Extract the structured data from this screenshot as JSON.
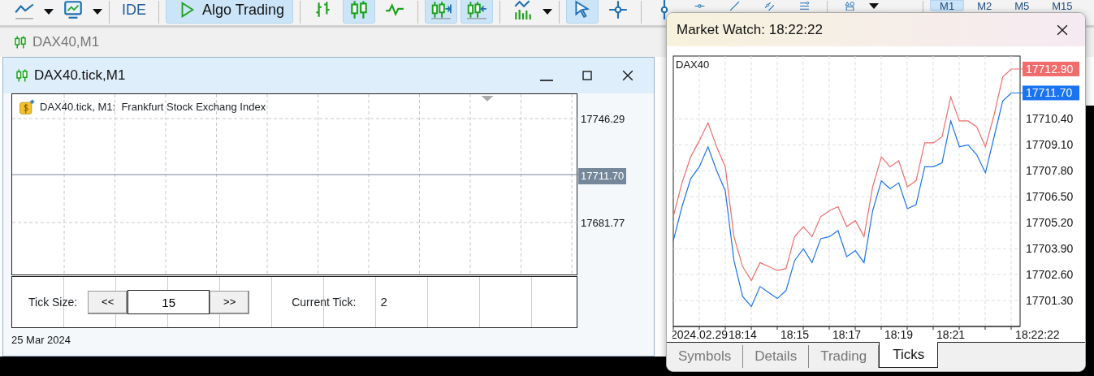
{
  "toolbar": {
    "items": [
      {
        "kind": "icon",
        "pressed": false
      },
      {
        "kind": "caret"
      },
      {
        "kind": "icon",
        "pressed": false
      },
      {
        "kind": "caret"
      },
      {
        "kind": "separator"
      },
      {
        "kind": "text",
        "label": "IDE",
        "pressed": false
      },
      {
        "kind": "separator"
      },
      {
        "kind": "play",
        "label": "Algo Trading",
        "pressed": true
      },
      {
        "kind": "separator"
      },
      {
        "kind": "icon",
        "pressed": false
      },
      {
        "kind": "icon",
        "pressed": true
      },
      {
        "kind": "icon",
        "pressed": false
      },
      {
        "kind": "separator"
      },
      {
        "kind": "icon",
        "pressed": true
      },
      {
        "kind": "icon",
        "pressed": true
      },
      {
        "kind": "separator"
      },
      {
        "kind": "icon",
        "pressed": false
      },
      {
        "kind": "caret"
      },
      {
        "kind": "separator"
      },
      {
        "kind": "icon",
        "pressed": true
      },
      {
        "kind": "icon",
        "pressed": false
      },
      {
        "kind": "separator"
      },
      {
        "kind": "icon",
        "pressed": false
      },
      {
        "kind": "icon",
        "pressed": false
      },
      {
        "kind": "icon",
        "pressed": false
      },
      {
        "kind": "icon",
        "pressed": false
      },
      {
        "kind": "icon",
        "pressed": false
      },
      {
        "kind": "separator"
      },
      {
        "kind": "icon",
        "pressed": false
      },
      {
        "kind": "caret"
      },
      {
        "kind": "separator"
      },
      {
        "kind": "text",
        "label": "M1",
        "pressed": true
      },
      {
        "kind": "text",
        "label": "M2",
        "pressed": false
      },
      {
        "kind": "text",
        "label": "M5",
        "pressed": false
      },
      {
        "kind": "text",
        "label": "M15",
        "pressed": false
      }
    ]
  },
  "document_tab": {
    "label": "DAX40,M1"
  },
  "chart_window": {
    "title": "DAX40.tick,M1",
    "chart": {
      "header": "DAX40.tick, M1:  Frankfurt Stock Exchang Index",
      "price_labels": [
        "17746.29",
        "17681.77"
      ],
      "current_price": "17711.70"
    },
    "controls": {
      "tick_size_label": "Tick Size:",
      "prev_button": "<<",
      "tick_size_value": "15",
      "next_button": ">>",
      "current_tick_label": "Current Tick:",
      "current_tick_value": "2"
    },
    "date_label": "25 Mar 2024"
  },
  "market_watch": {
    "title": "Market Watch: 18:22:22",
    "chart": {
      "symbol": "DAX40",
      "chart_data": {
        "type": "line",
        "categories": [
          null,
          null,
          null,
          "2024.02.29",
          null,
          null,
          null,
          null,
          "18:14",
          null,
          null,
          null,
          null,
          null,
          "18:15",
          null,
          null,
          null,
          null,
          null,
          "18:17",
          null,
          null,
          null,
          null,
          null,
          "18:19",
          null,
          null,
          null,
          null,
          null,
          "18:21",
          null,
          null,
          null,
          null,
          null,
          null,
          null,
          null,
          null,
          "18:22:22",
          null
        ],
        "series": [
          {
            "color": "#f26c6c",
            "values": [
              17705.5,
              17707.2,
              17708.5,
              17709.3,
              17710.2,
              17709.0,
              17708.0,
              17704.5,
              17703.0,
              17702.3,
              17703.2,
              17703.0,
              17702.8,
              17702.9,
              17704.5,
              17705.0,
              17704.5,
              17705.5,
              17705.8,
              17706.0,
              17705.0,
              17705.3,
              17704.5,
              17707.0,
              17708.5,
              17708.0,
              17708.3,
              17707.0,
              17707.3,
              17709.2,
              17709.2,
              17709.5,
              17711.5,
              17710.3,
              17710.3,
              17710.0,
              17709.0,
              17710.6,
              17712.5,
              17712.9,
              null,
              null,
              null,
              null
            ]
          },
          {
            "color": "#1a73f0",
            "values": [
              17704.3,
              17706.0,
              17707.4,
              17708.0,
              17709.0,
              17707.8,
              17706.8,
              17703.3,
              17701.5,
              17701.0,
              17702.0,
              17701.7,
              17701.4,
              17701.8,
              17703.3,
              17703.9,
              17703.2,
              17704.4,
              17704.5,
              17704.8,
              17703.5,
              17703.8,
              17703.2,
              17705.8,
              17707.3,
              17706.9,
              17707.2,
              17705.9,
              17706.1,
              17708.0,
              17708.0,
              17708.2,
              17710.3,
              17709.0,
              17709.1,
              17708.6,
              17707.7,
              17709.5,
              17711.3,
              17711.7,
              null,
              null,
              null,
              null
            ]
          }
        ],
        "ylim": [
          17700.0,
          17713.55
        ],
        "grid": true,
        "yticks": [
          {
            "value": 17701.3,
            "label": "17701.30"
          },
          {
            "value": 17702.6,
            "label": "17702.60"
          },
          {
            "value": 17703.9,
            "label": "17703.90"
          },
          {
            "value": 17705.2,
            "label": "17705.20"
          },
          {
            "value": 17706.5,
            "label": "17706.50"
          },
          {
            "value": 17707.8,
            "label": "17707.80"
          },
          {
            "value": 17709.1,
            "label": "17709.10"
          },
          {
            "value": 17710.4,
            "label": "17710.40"
          }
        ],
        "annotations": [
          "17712.90",
          "17711.70"
        ]
      }
    },
    "tabs": [
      {
        "label": "Symbols",
        "selected": false
      },
      {
        "label": "Details",
        "selected": false
      },
      {
        "label": "Trading",
        "selected": false
      },
      {
        "label": "Ticks",
        "selected": true
      }
    ]
  }
}
